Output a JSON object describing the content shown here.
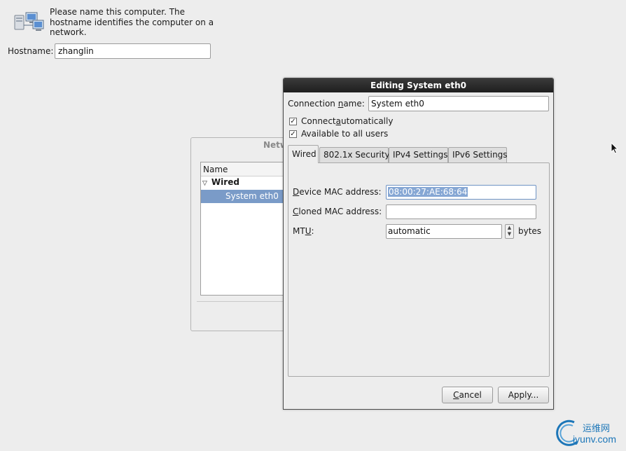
{
  "hostname": {
    "intro": "Please name this computer.  The hostname identifies the computer on a network.",
    "label": "Hostname:",
    "value": "zhanglin",
    "icon": "network-computers-icon"
  },
  "network_window": {
    "title_partial": "Netw",
    "column_header": "Name",
    "group": "Wired",
    "item": "System eth0"
  },
  "dialog": {
    "title": "Editing System eth0",
    "connection_name_label": {
      "pre": "Connection ",
      "u": "n",
      "post": "ame:"
    },
    "connection_name_value": "System eth0",
    "connect_auto": {
      "pre": "Connect ",
      "u": "a",
      "post": "utomatically",
      "checked": true
    },
    "available_all": {
      "label": "Available to all users",
      "checked": true
    },
    "tabs": [
      "Wired",
      "802.1x Security",
      "IPv4 Settings",
      "IPv6 Settings"
    ],
    "active_tab": "Wired",
    "device_mac_label": {
      "pre": "",
      "u": "D",
      "post": "evice MAC address:"
    },
    "device_mac_value": "08:00:27:AE:68:64",
    "cloned_mac_label": {
      "pre": "",
      "u": "C",
      "post": "loned MAC address:"
    },
    "cloned_mac_value": "",
    "mtu_label": {
      "pre": "MT",
      "u": "U",
      "post": ":"
    },
    "mtu_value": "automatic",
    "mtu_unit": "bytes",
    "cancel_button": {
      "pre": "",
      "u": "C",
      "post": "ancel"
    },
    "apply_button": "Apply..."
  },
  "watermark": {
    "cn": "运维网",
    "en": "iyunv.com",
    "color": "#1c76b8"
  },
  "colors": {
    "selection": "#7a9bc8",
    "titlebar": "#2a2a2a",
    "background": "#ededed"
  }
}
